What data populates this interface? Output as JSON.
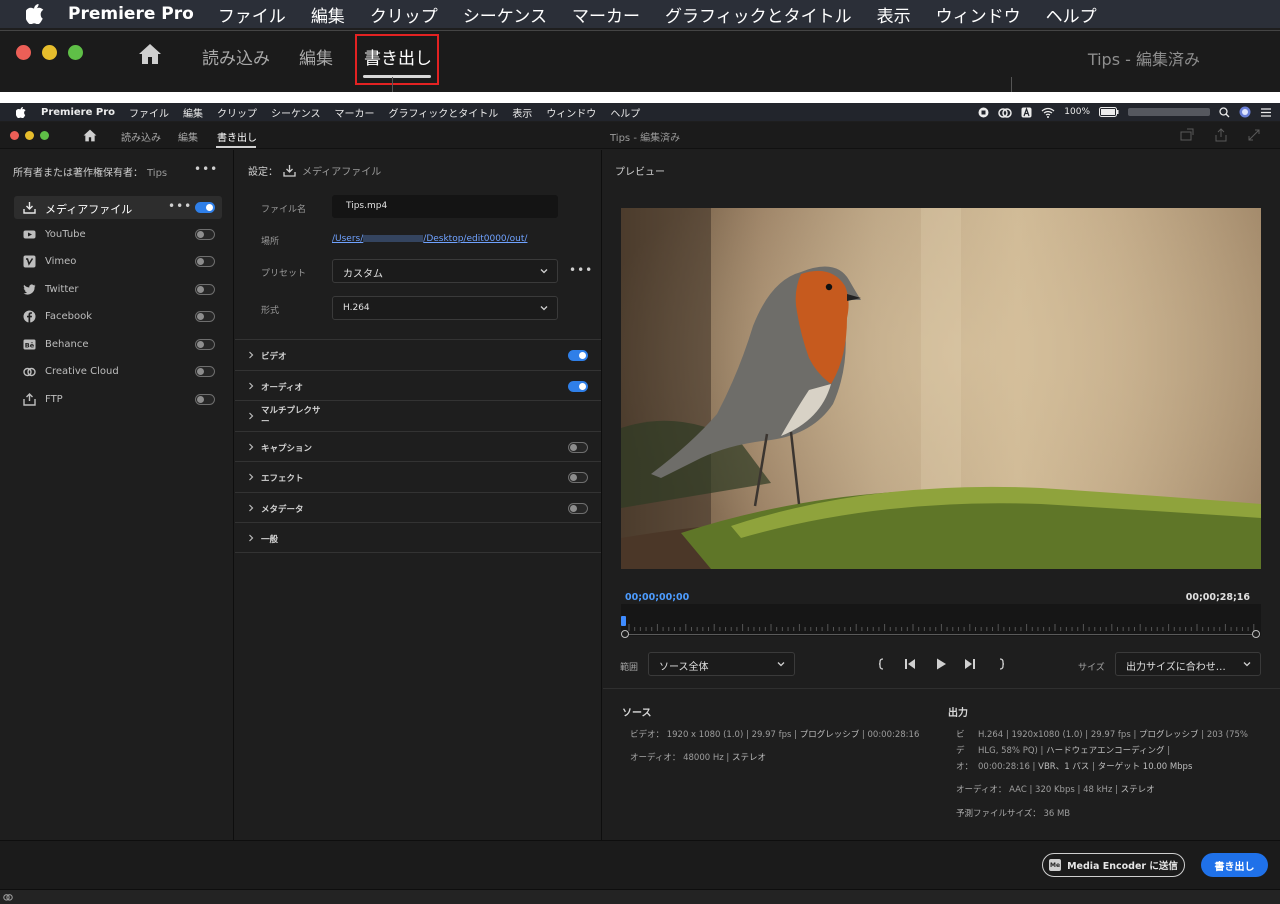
{
  "zoom": {
    "app_name": "Premiere Pro",
    "menu": [
      "ファイル",
      "編集",
      "クリップ",
      "シーケンス",
      "マーカー",
      "グラフィックとタイトル",
      "表示",
      "ウィンドウ",
      "ヘルプ"
    ],
    "tabs": [
      "読み込み",
      "編集",
      "書き出し"
    ],
    "active_tab": "書き出し",
    "window_title": "Tips - 編集済み"
  },
  "menubar": {
    "app_name": "Premiere Pro",
    "items": [
      "ファイル",
      "編集",
      "クリップ",
      "シーケンス",
      "マーカー",
      "グラフィックとタイトル",
      "表示",
      "ウィンドウ",
      "ヘルプ"
    ],
    "battery": "100%"
  },
  "titlebar": {
    "tabs": [
      "読み込み",
      "編集",
      "書き出し"
    ],
    "window_title": "Tips - 編集済み"
  },
  "left": {
    "owner_label": "所有者または著作権保有者：",
    "owner_value": "Tips",
    "destinations": [
      {
        "label": "メディアファイル",
        "icon": "download-icon",
        "on": true
      },
      {
        "label": "YouTube",
        "icon": "youtube-icon",
        "on": false
      },
      {
        "label": "Vimeo",
        "icon": "vimeo-icon",
        "on": false
      },
      {
        "label": "Twitter",
        "icon": "twitter-icon",
        "on": false
      },
      {
        "label": "Facebook",
        "icon": "facebook-icon",
        "on": false
      },
      {
        "label": "Behance",
        "icon": "behance-icon",
        "on": false
      },
      {
        "label": "Creative Cloud",
        "icon": "creative-cloud-icon",
        "on": false
      },
      {
        "label": "FTP",
        "icon": "upload-icon",
        "on": false
      }
    ]
  },
  "settings": {
    "header": "設定：",
    "target": "メディアファイル",
    "filename_label": "ファイル名",
    "filename": "Tips.mp4",
    "location_label": "場所",
    "location_prefix": "/Users/",
    "location_suffix": "/Desktop/edit0000/out/",
    "preset_label": "プリセット",
    "preset": "カスタム",
    "format_label": "形式",
    "format": "H.264",
    "sections": [
      {
        "label": "ビデオ",
        "toggle": "on"
      },
      {
        "label": "オーディオ",
        "toggle": "on"
      },
      {
        "label": "マルチプレクサー",
        "toggle": "none"
      },
      {
        "label": "キャプション",
        "toggle": "off"
      },
      {
        "label": "エフェクト",
        "toggle": "off"
      },
      {
        "label": "メタデータ",
        "toggle": "off"
      },
      {
        "label": "一般",
        "toggle": "none"
      }
    ]
  },
  "preview": {
    "label": "プレビュー",
    "timecode_in": "00;00;00;00",
    "timecode_out": "00;00;28;16",
    "range_label": "範囲",
    "range": "ソース全体",
    "size_label": "サイズ",
    "size": "出力サイズに合わせ…",
    "playhead_fraction": 0
  },
  "source": {
    "heading": "ソース",
    "video_label": "ビデオ：",
    "video_res": "1920 x 1080 (1.0)",
    "video_fps": "29.97 fps",
    "video_scan": "プログレッシブ",
    "video_dur": "00:00:28:16",
    "audio_label": "オーディオ：",
    "audio_rate": "48000 Hz",
    "audio_ch": "ステレオ"
  },
  "output": {
    "heading": "出力",
    "video_label_1": "ビ",
    "video_label_2": "デ",
    "video_label_3": "オ：",
    "video_line1a": "H.264",
    "video_line1b": "1920x1080 (1.0)",
    "video_line1c": "29.97 fps",
    "video_line1d": "プログレッシブ",
    "video_line1e": "203 (75%",
    "video_line2a": "HLG, 58% PQ)",
    "video_line2b": "ハードウェアエンコーディング",
    "video_line3a": "00:00:28:16",
    "video_line3b": "VBR、1 パス",
    "video_line3c": "ターゲット 10.00 Mbps",
    "audio_label": "オーディオ：",
    "audio_codec": "AAC",
    "audio_bitrate": "320 Kbps",
    "audio_rate": "48 kHz",
    "audio_ch": "ステレオ",
    "size_label": "予測ファイルサイズ：",
    "size": "36 MB"
  },
  "footer": {
    "media_encoder": "Media Encoder に送信",
    "export": "書き出し"
  },
  "colors": {
    "accent": "#1f71e9",
    "highlight_box": "#e32222",
    "link": "#6fa2ff"
  }
}
